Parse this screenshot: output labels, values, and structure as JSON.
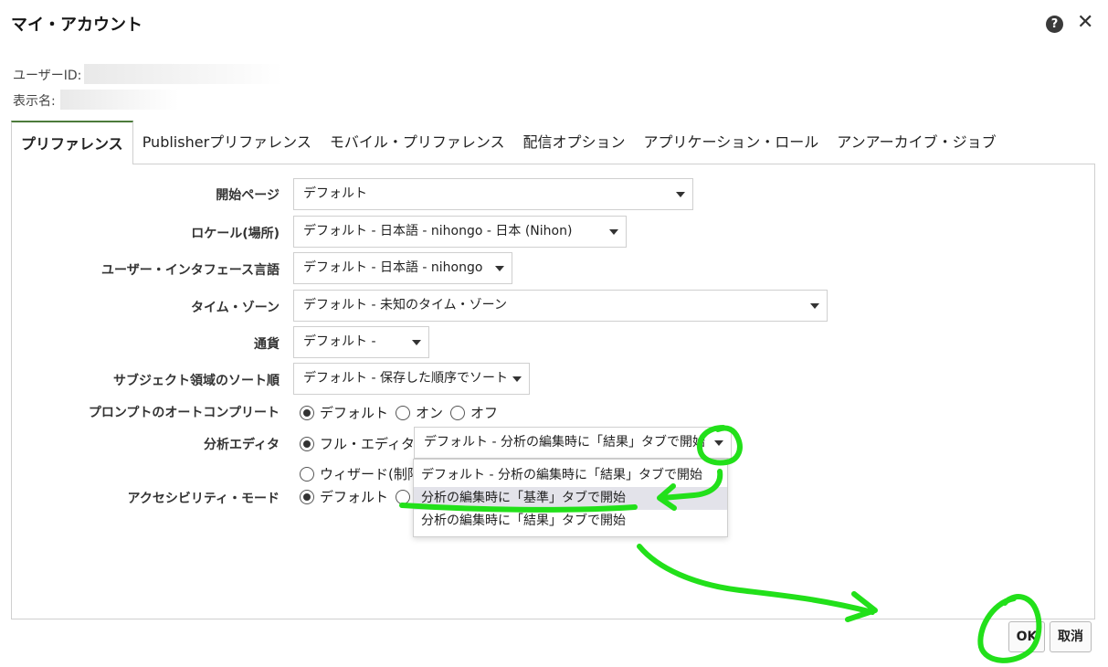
{
  "dialog": {
    "title": "マイ・アカウント",
    "help_glyph": "?",
    "close_glyph": "✕",
    "user_id_label": "ユーザーID:",
    "display_name_label": "表示名:"
  },
  "tabs": [
    {
      "label": "プリファレンス",
      "active": true
    },
    {
      "label": "Publisherプリファレンス"
    },
    {
      "label": "モバイル・プリファレンス"
    },
    {
      "label": "配信オプション"
    },
    {
      "label": "アプリケーション・ロール"
    },
    {
      "label": "アンアーカイブ・ジョブ"
    }
  ],
  "form": {
    "start_page": {
      "label": "開始ページ",
      "value": "デフォルト"
    },
    "locale": {
      "label": "ロケール(場所)",
      "value": "デフォルト - 日本語 - nihongo - 日本 (Nihon)"
    },
    "ui_language": {
      "label": "ユーザー・インタフェース言語",
      "value": "デフォルト - 日本語 - nihongo"
    },
    "time_zone": {
      "label": "タイム・ゾーン",
      "value": "デフォルト - 未知のタイム・ゾーン"
    },
    "currency": {
      "label": "通貨",
      "value": "デフォルト -"
    },
    "subject_sort": {
      "label": "サブジェクト領域のソート順",
      "value": "デフォルト - 保存した順序でソート"
    },
    "prompt_autocomplete": {
      "label": "プロンプトのオートコンプリート",
      "options": [
        "デフォルト",
        "オン",
        "オフ"
      ],
      "selected": "デフォルト"
    },
    "analysis_editor": {
      "label": "分析エディタ",
      "option_full": "フル・エディタ",
      "option_wizard": "ウィザード(制限",
      "select_value": "デフォルト - 分析の編集時に「結果」タブで開始",
      "dropdown_options": [
        "デフォルト - 分析の編集時に「結果」タブで開始",
        "分析の編集時に「基準」タブで開始",
        "分析の編集時に「結果」タブで開始"
      ],
      "hovered_index": 1
    },
    "accessibility": {
      "label": "アクセシビリティ・モード",
      "option_default": "デフォルト"
    }
  },
  "buttons": {
    "ok": "OK",
    "cancel": "取消"
  },
  "colors": {
    "annotation": "#22e01a",
    "tab_accent": "#4c7b3a",
    "hover": "#e3e3ea"
  }
}
